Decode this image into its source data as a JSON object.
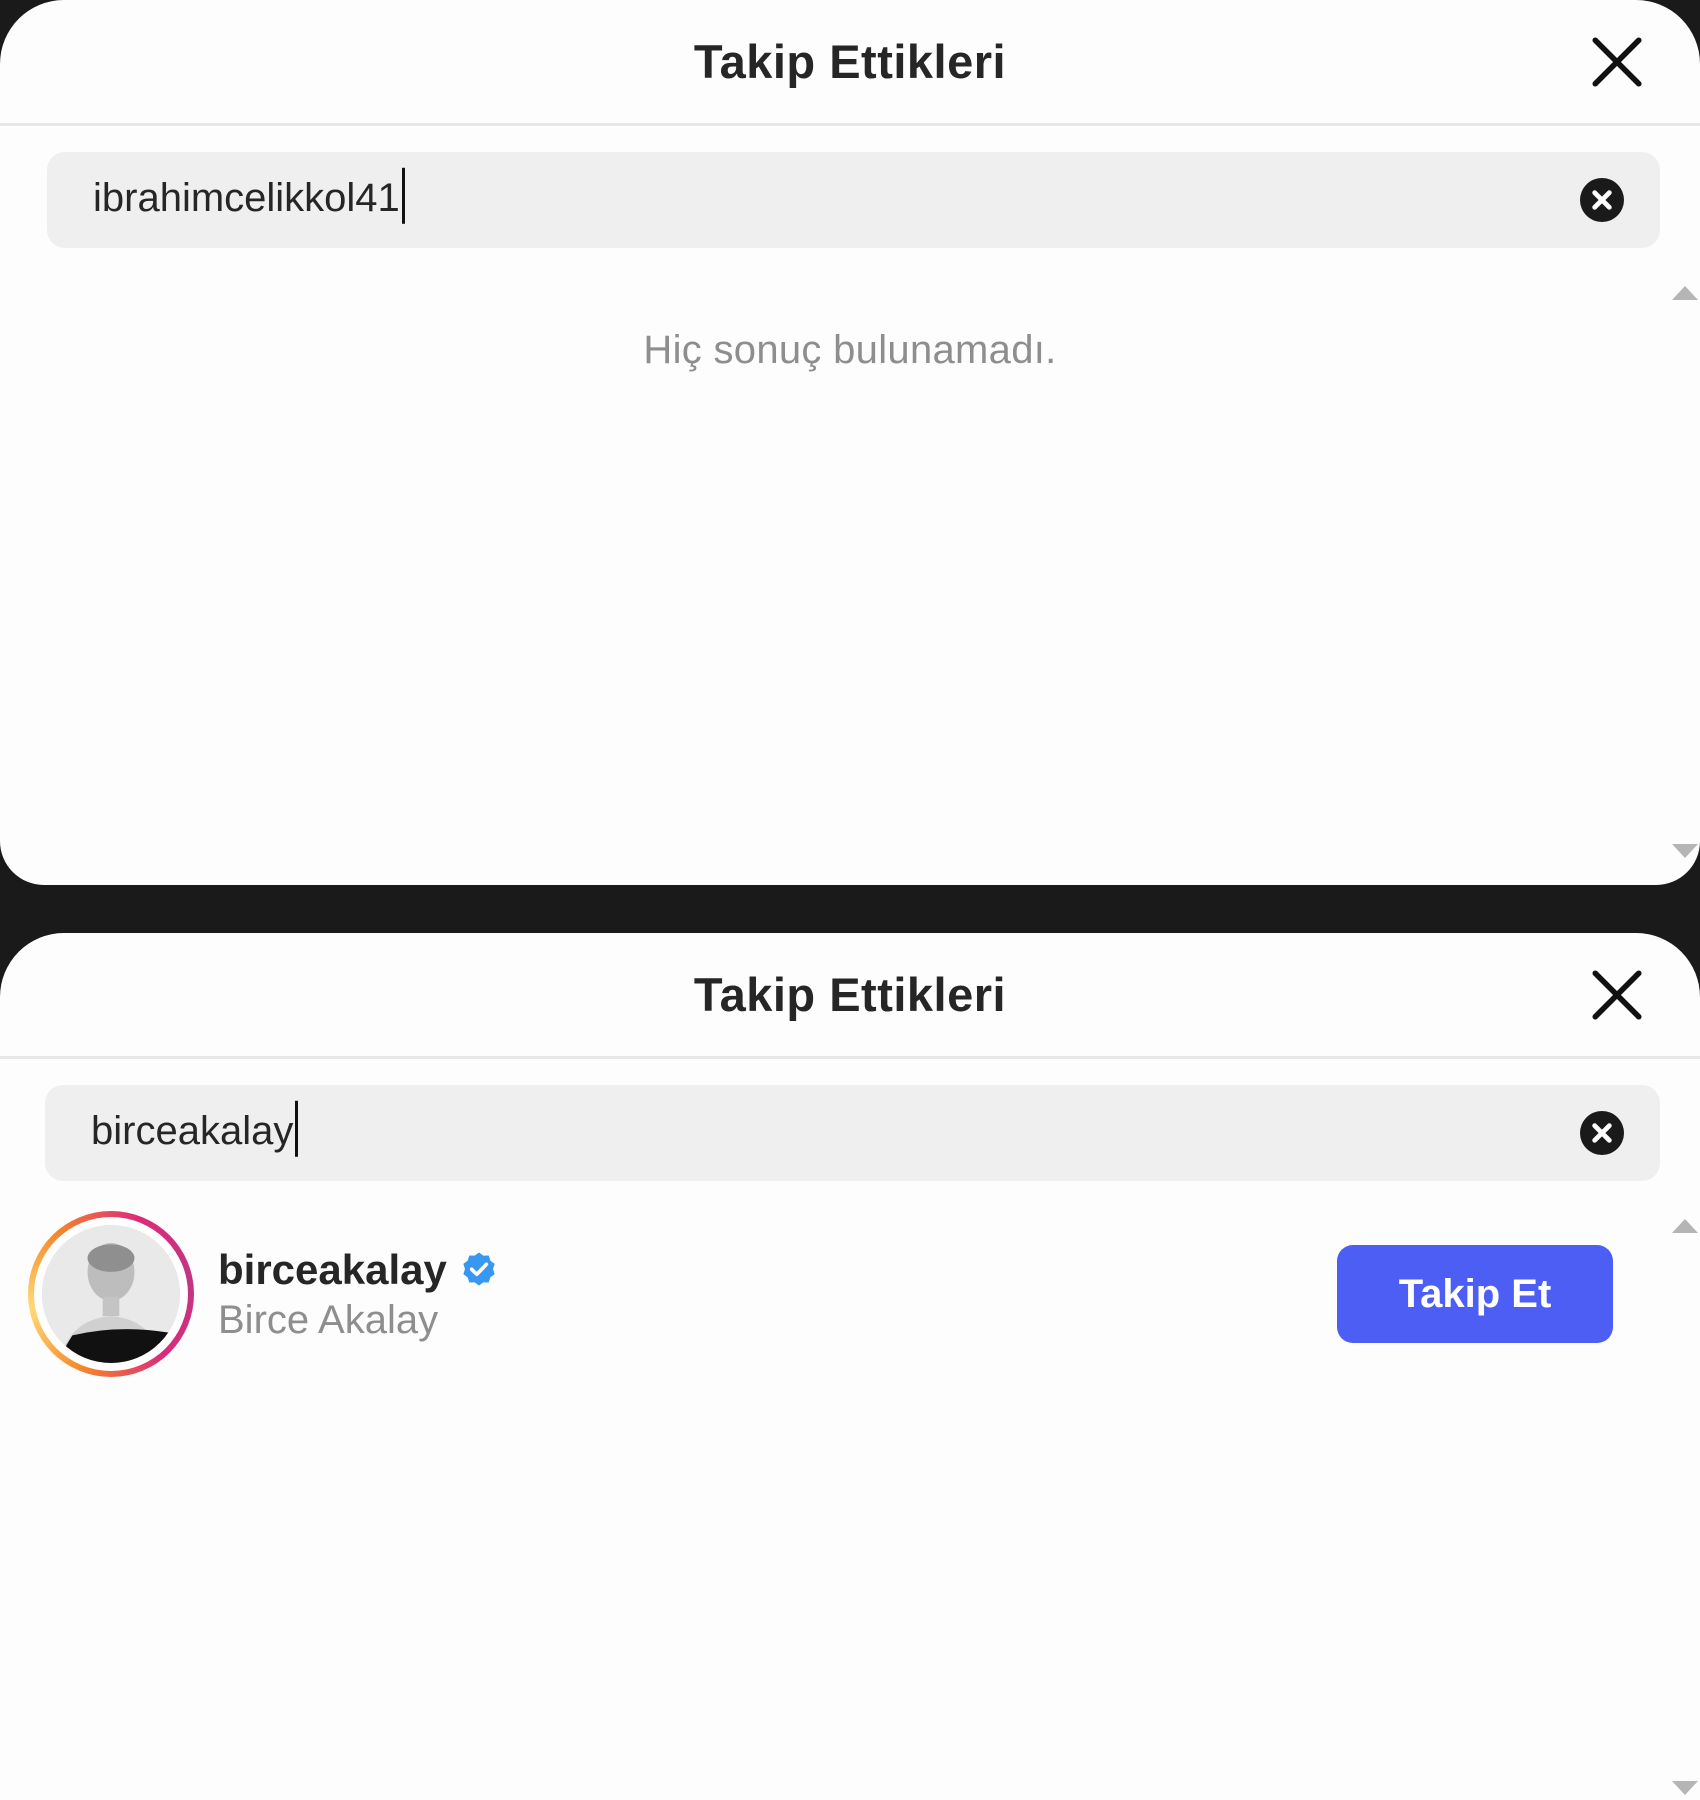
{
  "top_modal": {
    "title": "Takip Ettikleri",
    "search": {
      "value": "ibrahimcelikkol41"
    },
    "empty_message": "Hiç sonuç bulunamadı."
  },
  "bottom_modal": {
    "title": "Takip Ettikleri",
    "search": {
      "value": "birceakalay"
    },
    "results": [
      {
        "username": "birceakalay",
        "full_name": "Birce Akalay",
        "verified": true,
        "follow_label": "Takip Et"
      }
    ]
  },
  "icons": {
    "close": "close-icon",
    "clear": "clear-search-icon",
    "verified": "verified-badge-icon",
    "scroll_up": "scroll-up-arrow-icon",
    "scroll_down": "scroll-down-arrow-icon"
  },
  "colors": {
    "follow_button": "#4c5ef3",
    "verified_badge": "#3897f0",
    "muted_text": "#8e8e8e",
    "search_bg": "#efefef"
  }
}
